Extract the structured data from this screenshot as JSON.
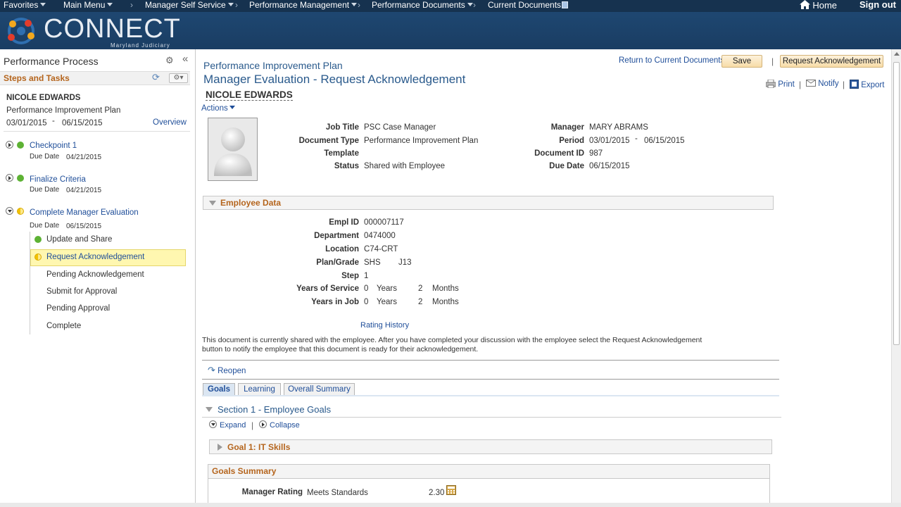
{
  "topnav": {
    "items": [
      {
        "label": "Favorites"
      },
      {
        "label": "Main Menu"
      },
      {
        "label": "Manager Self Service"
      },
      {
        "label": "Performance Management"
      },
      {
        "label": "Performance Documents"
      },
      {
        "label": "Current Documents"
      }
    ],
    "home": "Home",
    "signout": "Sign out"
  },
  "banner": {
    "logo_text": "CONNECT",
    "logo_sub": "Maryland Judiciary"
  },
  "left": {
    "title": "Performance Process",
    "steps_header": "Steps and Tasks",
    "employee_name": "NICOLE EDWARDS",
    "doc_type": "Performance Improvement Plan",
    "start": "03/01/2015",
    "dash": "-",
    "end": "06/15/2015",
    "overview": "Overview",
    "due_label": "Due Date",
    "steps": [
      {
        "title": "Checkpoint 1",
        "due": "04/21/2015"
      },
      {
        "title": "Finalize Criteria",
        "due": "04/21/2015"
      },
      {
        "title": "Complete Manager Evaluation",
        "due": "06/15/2015"
      }
    ],
    "tasks": [
      {
        "label": "Update and Share"
      },
      {
        "label": "Request Acknowledgement"
      },
      {
        "label": "Pending Acknowledgement"
      },
      {
        "label": "Submit for Approval"
      },
      {
        "label": "Pending Approval"
      },
      {
        "label": "Complete"
      }
    ]
  },
  "main": {
    "doc_type": "Performance Improvement Plan",
    "title": "Manager Evaluation - Request Acknowledgement",
    "employee": "NICOLE EDWARDS",
    "actions": "Actions",
    "return_link": "Return to Current Documents",
    "save": "Save",
    "pipe": "|",
    "request_ack": "Request Acknowledgement",
    "print": "Print",
    "notify": "Notify",
    "export": "Export",
    "header_fields": {
      "job_title_label": "Job Title",
      "job_title": "PSC Case Manager",
      "doc_type_label": "Document Type",
      "doc_type": "Performance Improvement Plan",
      "template_label": "Template",
      "status_label": "Status",
      "status": "Shared with Employee",
      "manager_label": "Manager",
      "manager": "MARY ABRAMS",
      "period_label": "Period",
      "period_start": "03/01/2015",
      "period_dash": "-",
      "period_end": "06/15/2015",
      "docid_label": "Document ID",
      "docid": "987",
      "due_label": "Due Date",
      "due": "06/15/2015"
    },
    "employee_data": {
      "header": "Employee Data",
      "emplid_label": "Empl ID",
      "emplid": "000007117",
      "dept_label": "Department",
      "dept": "0474000",
      "location_label": "Location",
      "location": "C74-CRT",
      "plan_label": "Plan/Grade",
      "plan": "SHS",
      "grade": "J13",
      "step_label": "Step",
      "step": "1",
      "yos_label": "Years of Service",
      "yos_years": "0",
      "yos_months": "2",
      "yij_label": "Years in Job",
      "yij_years": "0",
      "yij_months": "2",
      "years_word": "Years",
      "months_word": "Months"
    },
    "rating_history": "Rating History",
    "info_line1": "This document is currently shared with the employee. After you have completed your discussion with the employee select the Request Acknowledgement",
    "info_line2": "button to notify the employee that this document is ready for their acknowledgement.",
    "reopen": "Reopen",
    "tabs": [
      {
        "label": "Goals"
      },
      {
        "label": "Learning"
      },
      {
        "label": "Overall Summary"
      }
    ],
    "section1": "Section 1 - Employee Goals",
    "expand": "Expand",
    "collapse": "Collapse",
    "goal1": "Goal 1: IT Skills",
    "goals_summary": "Goals Summary",
    "manager_rating_label": "Manager Rating",
    "manager_rating": "Meets Standards",
    "manager_score": "2.30"
  }
}
